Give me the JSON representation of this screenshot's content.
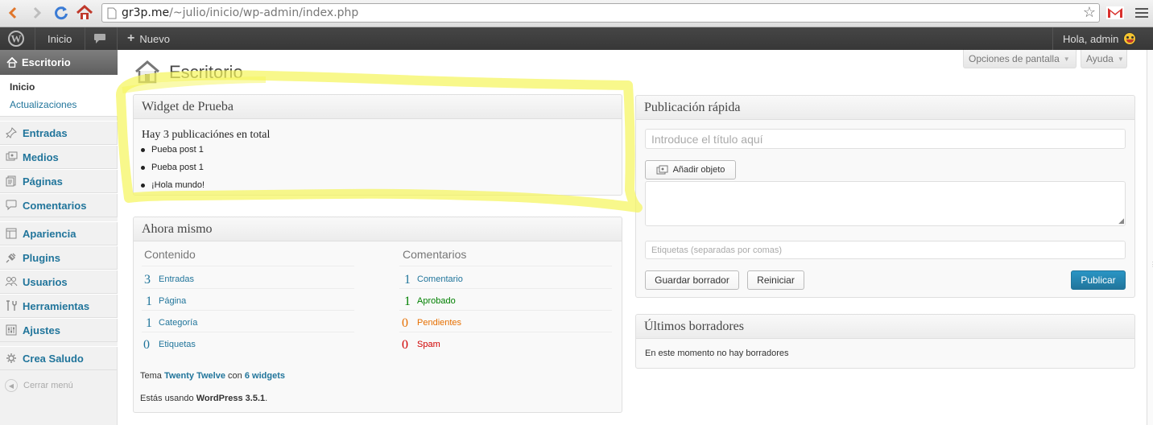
{
  "browser": {
    "url_domain": "gr3p.me",
    "url_path": "/~julio/inicio/wp-admin/index.php"
  },
  "adminbar": {
    "home": "Inicio",
    "new": "Nuevo",
    "greeting": "Hola, admin"
  },
  "sidebar": {
    "current": "Escritorio",
    "submenu": [
      "Inicio",
      "Actualizaciones"
    ],
    "items": [
      "Entradas",
      "Medios",
      "Páginas",
      "Comentarios",
      "Apariencia",
      "Plugins",
      "Usuarios",
      "Herramientas",
      "Ajustes",
      "Crea Saludo"
    ],
    "collapse": "Cerrar menú"
  },
  "page": {
    "title": "Escritorio",
    "screen_options": "Opciones de pantalla",
    "help": "Ayuda"
  },
  "widget_prueba": {
    "title": "Widget de Prueba",
    "intro": "Hay 3 publicaciónes en total",
    "posts": [
      "Pueba post 1",
      "Pueba post 1",
      "¡Hola mundo!"
    ]
  },
  "right_now": {
    "title": "Ahora mismo",
    "content_head": "Contenido",
    "comments_head": "Comentarios",
    "content": [
      {
        "count": "3",
        "label": "Entradas"
      },
      {
        "count": "1",
        "label": "Página"
      },
      {
        "count": "1",
        "label": "Categoría"
      },
      {
        "count": "0",
        "label": "Etiquetas"
      }
    ],
    "comments": [
      {
        "count": "1",
        "label": "Comentario",
        "color": "#21759b"
      },
      {
        "count": "1",
        "label": "Aprobado",
        "color": "#008000"
      },
      {
        "count": "0",
        "label": "Pendientes",
        "color": "#e66f00"
      },
      {
        "count": "0",
        "label": "Spam",
        "color": "#d00000"
      }
    ],
    "theme_prefix": "Tema",
    "theme_name": "Twenty Twelve",
    "theme_mid": "con",
    "widgets_link": "6 widgets",
    "wp_prefix": "Estás usando",
    "wp_version": "WordPress 3.5.1",
    "wp_suffix": "."
  },
  "quick_press": {
    "title": "Publicación rápida",
    "title_placeholder": "Introduce el título aquí",
    "add_media": "Añadir objeto",
    "tags_placeholder": "Etiquetas (separadas por comas)",
    "save_draft": "Guardar borrador",
    "reset": "Reiniciar",
    "publish": "Publicar"
  },
  "recent_drafts": {
    "title": "Últimos borradores",
    "empty": "En este momento no hay borradores"
  },
  "colors": {
    "link": "#21759b",
    "highlighter": "#f5f55a",
    "primary_button": "#21759b"
  }
}
